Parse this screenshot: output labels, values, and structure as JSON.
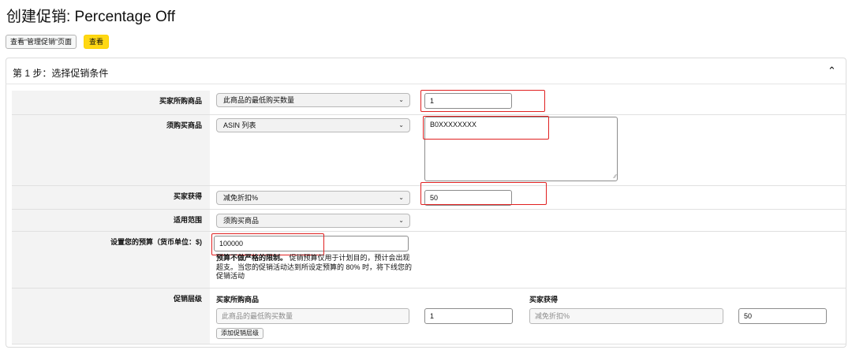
{
  "page": {
    "title": "创建促销: Percentage Off"
  },
  "toolbar": {
    "view_manage_label": "查看“管理促销”页面",
    "view_label": "查看"
  },
  "step": {
    "title": "第 1 步：选择促销条件"
  },
  "rows": {
    "buyer_purchases": {
      "label": "买家所购商品",
      "select_value": "此商品的最低购买数量",
      "input_value": "1"
    },
    "purchased_items": {
      "label": "须购买商品",
      "select_value": "ASIN 列表",
      "textarea_value": "B0XXXXXXXX"
    },
    "buyer_gets": {
      "label": "买家获得",
      "select_value": "减免折扣%",
      "input_value": "50"
    },
    "applies_to": {
      "label": "适用范围",
      "select_value": "须购买商品"
    },
    "budget": {
      "label": "设置您的预算（货币单位：$)",
      "input_value": "100000",
      "note_bold": "预算不做严格的限制。",
      "note_text": "促销预算仅用于计划目的，预计会出现超支。当您的促销活动达到所设定预算的 80% 时，将下线您的促销活动"
    },
    "tiers": {
      "label": "促销层级",
      "col_buyer_purchases": "买家所购商品",
      "col_buyer_gets": "买家获得",
      "purchase_type_value": "此商品的最低购买数量",
      "purchase_qty_value": "1",
      "gets_type_value": "减免折扣%",
      "gets_value": "50",
      "add_tier_label": "添加促销层级"
    }
  },
  "colors": {
    "accent_yellow": "#ffd814",
    "highlight_red": "#e02020",
    "label_bg": "#f3f3f3"
  }
}
